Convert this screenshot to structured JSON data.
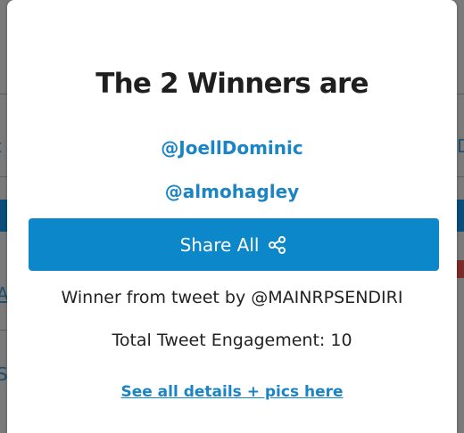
{
  "modal": {
    "title": "The 2 Winners are",
    "winners": [
      "@JoellDominic",
      "@almohagley"
    ],
    "share_button_label": "Share All",
    "share_icon": "share-icon",
    "tweet_source": "Winner from tweet by @MAINRPSENDIRI",
    "engagement": "Total Tweet Engagement: 10",
    "details_link": "See all details + pics here"
  },
  "colors": {
    "accent": "#0c87c9",
    "link": "#1a84c6",
    "title": "#1f1f1f",
    "overlay": "#7a7a7a"
  }
}
